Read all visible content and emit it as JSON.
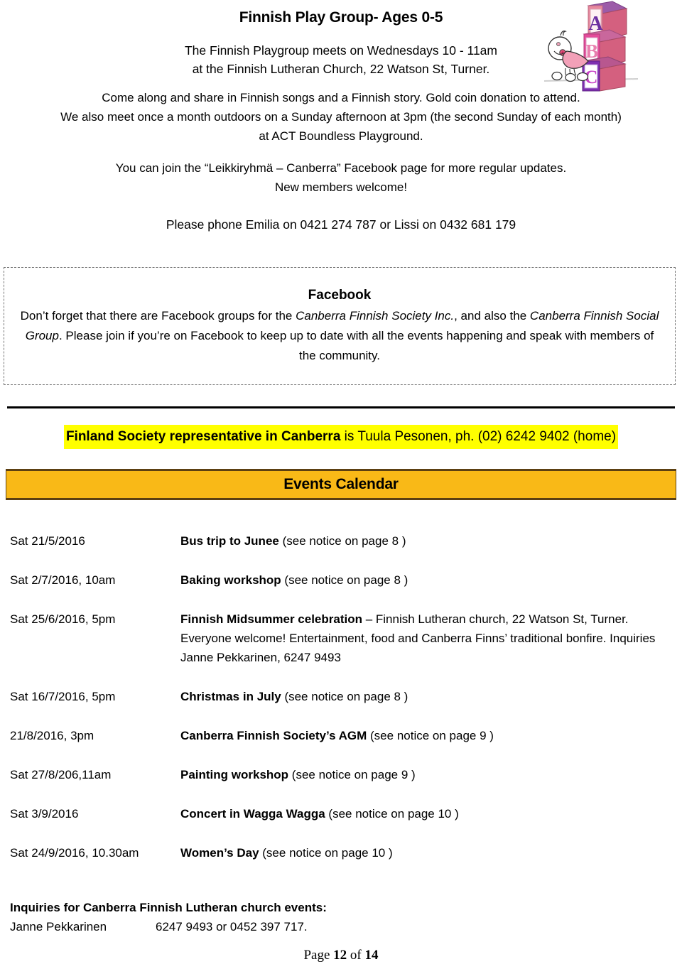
{
  "document": {
    "title": "Finnish Play Group- Ages 0-5"
  },
  "playgroup": {
    "heading": "Finnish Play Group- Ages 0-5",
    "meeting_line_1": "The Finnish Playgroup meets on Wednesdays 10 - 11am",
    "meeting_line_2": "at the Finnish Lutheran Church, 22 Watson St, Turner.",
    "body_line_1": "Come along and share in Finnish songs and a Finnish story. Gold coin donation to attend.",
    "body_line_2": "We also meet once a month outdoors on a Sunday afternoon at 3pm (the second Sunday of each month)",
    "body_line_3": "at ACT Boundless Playground.",
    "facebook_page_line": "You can join the “Leikkiryhmä – Canberra” Facebook page for more regular updates.",
    "new_members_line": "New members welcome!",
    "phone_line": "Please phone Emilia on 0421 274 787 or Lissi on 0432 681 179",
    "clipart_name": "abc-blocks-baby-clipart",
    "clipart_letters": [
      "A",
      "B",
      "C"
    ]
  },
  "facebook_box": {
    "title": "Facebook",
    "text_part_1": "Don’t forget that there are Facebook groups for the ",
    "italic_1": "Canberra Finnish Society Inc.",
    "text_part_2": ", and also the ",
    "italic_2": "Canberra Finnish Social Group",
    "text_part_3": ". Please join if you’re on Facebook to keep up to date with all the events happening and speak with members of the community."
  },
  "representative": {
    "bold_part": "Finland Society representative in Canberra",
    "rest_part": " is Tuula Pesonen, ph. (02) 6242 9402 (home)",
    "highlight_color": "#FFFF00"
  },
  "events_calendar": {
    "banner_label": "Events Calendar",
    "banner_color": "#F9B917",
    "banner_border_color": "#5C4012",
    "events": [
      {
        "date": "Sat 21/5/2016",
        "title": "Bus trip to Junee",
        "detail": " (see notice on page 8 )"
      },
      {
        "date": "Sat 2/7/2016, 10am",
        "title": "Baking workshop",
        "detail": " (see notice on page 8 )"
      },
      {
        "date": "Sat 25/6/2016, 5pm",
        "title": "Finnish Midsummer celebration",
        "detail": " – Finnish Lutheran church, 22 Watson St, Turner. Everyone welcome! Entertainment, food and Canberra Finns’ traditional bonfire. Inquiries Janne Pekkarinen, 6247 9493"
      },
      {
        "date": "Sat 16/7/2016, 5pm",
        "title": "Christmas in July",
        "detail": " (see notice on page 8 )"
      },
      {
        "date": "21/8/2016, 3pm",
        "title": "Canberra Finnish Society’s AGM",
        "detail": " (see notice on page 9 )"
      },
      {
        "date": "Sat 27/8/206,11am",
        "title": "Painting workshop",
        "detail": " (see notice on page 9 )"
      },
      {
        "date": "Sat 3/9/2016",
        "title": "Concert in Wagga Wagga",
        "detail": " (see notice on page 10 )"
      },
      {
        "date": "Sat 24/9/2016, 10.30am",
        "title": "Women’s Day",
        "detail": " (see notice on page 10 )"
      }
    ]
  },
  "inquiries": {
    "heading": "Inquiries for Canberra Finnish Lutheran church events:",
    "contact_name": "Janne Pekkarinen",
    "contact_phone": "6247 9493 or 0452 397 717."
  },
  "footer": {
    "page_prefix": "Page ",
    "page_current": "12",
    "page_middle": " of ",
    "page_total": "14"
  }
}
